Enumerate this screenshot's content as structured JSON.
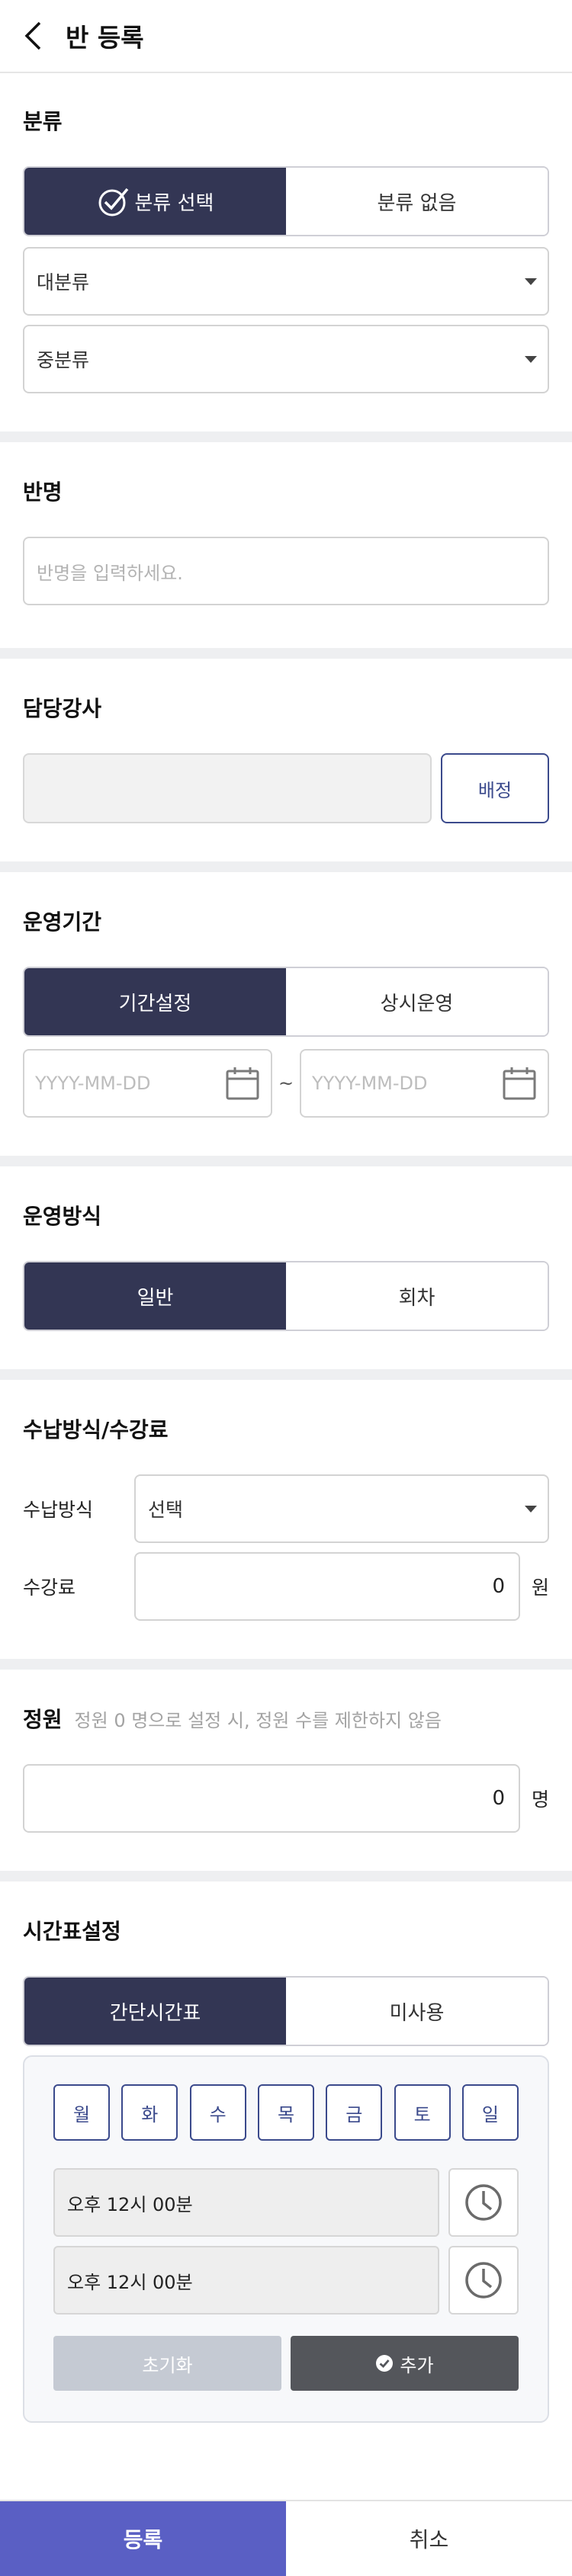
{
  "header": {
    "title": "반 등록",
    "back_icon": "chevron-left-icon"
  },
  "category": {
    "title": "분류",
    "options": [
      "분류 선택",
      "분류 없음"
    ],
    "selected": "분류 선택",
    "major_placeholder": "대분류",
    "middle_placeholder": "중분류"
  },
  "class_name": {
    "title": "반명",
    "placeholder": "반명을 입력하세요."
  },
  "instructor": {
    "title": "담당강사",
    "assign_label": "배정"
  },
  "period": {
    "title": "운영기간",
    "options": [
      "기간설정",
      "상시운영"
    ],
    "selected": "기간설정",
    "start_placeholder": "YYYY-MM-DD",
    "end_placeholder": "YYYY-MM-DD",
    "separator": "~"
  },
  "operation": {
    "title": "운영방식",
    "options": [
      "일반",
      "회차"
    ],
    "selected": "일반"
  },
  "payment": {
    "title": "수납방식/수강료",
    "method_label": "수납방식",
    "method_value": "선택",
    "fee_label": "수강료",
    "fee_value": "0",
    "fee_unit": "원"
  },
  "capacity": {
    "title": "정원",
    "hint": "정원 0 명으로 설정 시, 정원 수를 제한하지 않음",
    "value": "0",
    "unit": "명"
  },
  "timetable": {
    "title": "시간표설정",
    "options": [
      "간단시간표",
      "미사용"
    ],
    "selected": "간단시간표",
    "days": [
      "월",
      "화",
      "수",
      "목",
      "금",
      "토",
      "일"
    ],
    "start_time": "오후 12시 00분",
    "end_time": "오후 12시 00분",
    "reset_label": "초기화",
    "add_label": "추가"
  },
  "footer": {
    "submit_label": "등록",
    "cancel_label": "취소"
  },
  "colors": {
    "primary_dark": "#333654",
    "accent_blue": "#3b4a8c",
    "submit": "#5a5fc4"
  }
}
